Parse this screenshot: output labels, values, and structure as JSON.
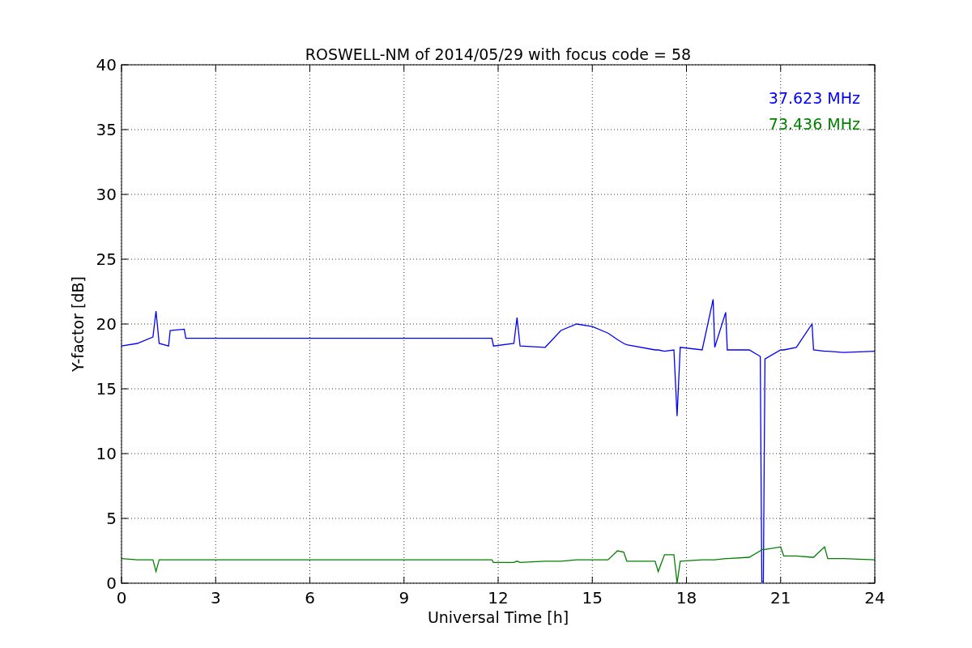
{
  "figure": {
    "chart_data": {
      "type": "line",
      "title": "ROSWELL-NM of 2014/05/29 with focus code = 58",
      "xlabel": "Universal Time [h]",
      "ylabel": "Y-factor [dB]",
      "x": [
        0,
        0.5,
        1,
        1.1,
        1.2,
        1.5,
        1.55,
        2,
        2.05,
        11.8,
        11.85,
        12.5,
        12.6,
        12.7,
        13.5,
        14,
        14.5,
        15,
        15.5,
        15.8,
        16,
        16.1,
        17,
        17.1,
        17.3,
        17.6,
        17.7,
        17.8,
        18.5,
        18.85,
        18.9,
        19.25,
        19.3,
        20,
        20.35,
        20.4,
        20.45,
        20.5,
        21,
        21.1,
        21.5,
        22,
        22.05,
        22.4,
        22.5,
        23,
        24
      ],
      "series": [
        {
          "name": "37.623 MHz",
          "color": "#0000ff",
          "values": [
            18.3,
            18.5,
            19.0,
            21.0,
            18.5,
            18.3,
            19.5,
            19.6,
            18.9,
            18.9,
            18.3,
            18.5,
            20.5,
            18.3,
            18.2,
            19.5,
            20.0,
            19.8,
            19.3,
            18.8,
            18.5,
            18.4,
            18.0,
            18.0,
            17.9,
            18.0,
            12.9,
            18.2,
            18.0,
            21.9,
            18.2,
            20.9,
            18.0,
            18.0,
            17.5,
            0.1,
            0.1,
            17.3,
            18.0,
            18.0,
            18.2,
            20.0,
            18.0,
            17.9,
            17.9,
            17.8,
            17.9
          ]
        },
        {
          "name": "73.436 MHz",
          "color": "#008000",
          "values": [
            1.9,
            1.8,
            1.8,
            0.9,
            1.8,
            1.8,
            1.8,
            1.8,
            1.8,
            1.8,
            1.6,
            1.6,
            1.7,
            1.6,
            1.7,
            1.7,
            1.8,
            1.8,
            1.8,
            2.5,
            2.4,
            1.7,
            1.7,
            0.9,
            2.2,
            2.2,
            0.0,
            1.7,
            1.8,
            1.8,
            1.8,
            1.9,
            1.9,
            2.0,
            2.5,
            2.6,
            2.6,
            2.6,
            2.8,
            2.1,
            2.1,
            2.0,
            2.0,
            2.8,
            1.9,
            1.9,
            1.8
          ]
        }
      ],
      "grid": true,
      "xlim": [
        0,
        24
      ],
      "ylim": [
        0,
        40
      ],
      "xticks": [
        0,
        3,
        6,
        9,
        12,
        15,
        18,
        21,
        24
      ],
      "yticks": [
        0,
        5,
        10,
        15,
        20,
        25,
        30,
        35,
        40
      ]
    }
  }
}
